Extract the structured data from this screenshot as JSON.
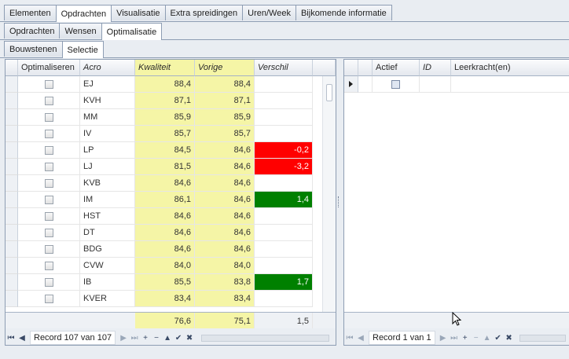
{
  "tabs_main": [
    "Elementen",
    "Opdrachten",
    "Visualisatie",
    "Extra spreidingen",
    "Uren/Week",
    "Bijkomende informatie"
  ],
  "tabs_sub": [
    "Opdrachten",
    "Wensen",
    "Optimalisatie"
  ],
  "tabs_sub2": [
    "Bouwstenen",
    "Selectie"
  ],
  "left_grid": {
    "columns": [
      "Optimaliseren",
      "Acro",
      "Kwaliteit",
      "Vorige",
      "Verschil"
    ],
    "rows": [
      {
        "acro": "EJ",
        "kwaliteit": "88,4",
        "vorige": "88,4",
        "verschil": ""
      },
      {
        "acro": "KVH",
        "kwaliteit": "87,1",
        "vorige": "87,1",
        "verschil": ""
      },
      {
        "acro": "MM",
        "kwaliteit": "85,9",
        "vorige": "85,9",
        "verschil": ""
      },
      {
        "acro": "IV",
        "kwaliteit": "85,7",
        "vorige": "85,7",
        "verschil": ""
      },
      {
        "acro": "LP",
        "kwaliteit": "84,5",
        "vorige": "84,6",
        "verschil": "-0,2"
      },
      {
        "acro": "LJ",
        "kwaliteit": "81,5",
        "vorige": "84,6",
        "verschil": "-3,2"
      },
      {
        "acro": "KVB",
        "kwaliteit": "84,6",
        "vorige": "84,6",
        "verschil": ""
      },
      {
        "acro": "IM",
        "kwaliteit": "86,1",
        "vorige": "84,6",
        "verschil": "1,4"
      },
      {
        "acro": "HST",
        "kwaliteit": "84,6",
        "vorige": "84,6",
        "verschil": ""
      },
      {
        "acro": "DT",
        "kwaliteit": "84,6",
        "vorige": "84,6",
        "verschil": ""
      },
      {
        "acro": "BDG",
        "kwaliteit": "84,6",
        "vorige": "84,6",
        "verschil": ""
      },
      {
        "acro": "CVW",
        "kwaliteit": "84,0",
        "vorige": "84,0",
        "verschil": ""
      },
      {
        "acro": "IB",
        "kwaliteit": "85,5",
        "vorige": "83,8",
        "verschil": "1,7"
      },
      {
        "acro": "KVER",
        "kwaliteit": "83,4",
        "vorige": "83,4",
        "verschil": ""
      }
    ],
    "footer": {
      "kwaliteit": "76,6",
      "vorige": "75,1",
      "verschil": "1,5"
    },
    "record_text": "Record 107 van 107"
  },
  "right_grid": {
    "columns": [
      "Actief",
      "ID",
      "Leerkracht(en)"
    ],
    "record_text": "Record 1 van 1"
  },
  "colors": {
    "negative": "#ff0000",
    "positive": "#008000",
    "highlight": "#f5f5a6"
  },
  "icons": {
    "nav_first": "⏮",
    "nav_prev": "◀",
    "nav_next": "▶",
    "nav_last": "⏭",
    "add": "+",
    "remove": "−",
    "up": "▲",
    "confirm": "✔",
    "cancel": "✖"
  }
}
